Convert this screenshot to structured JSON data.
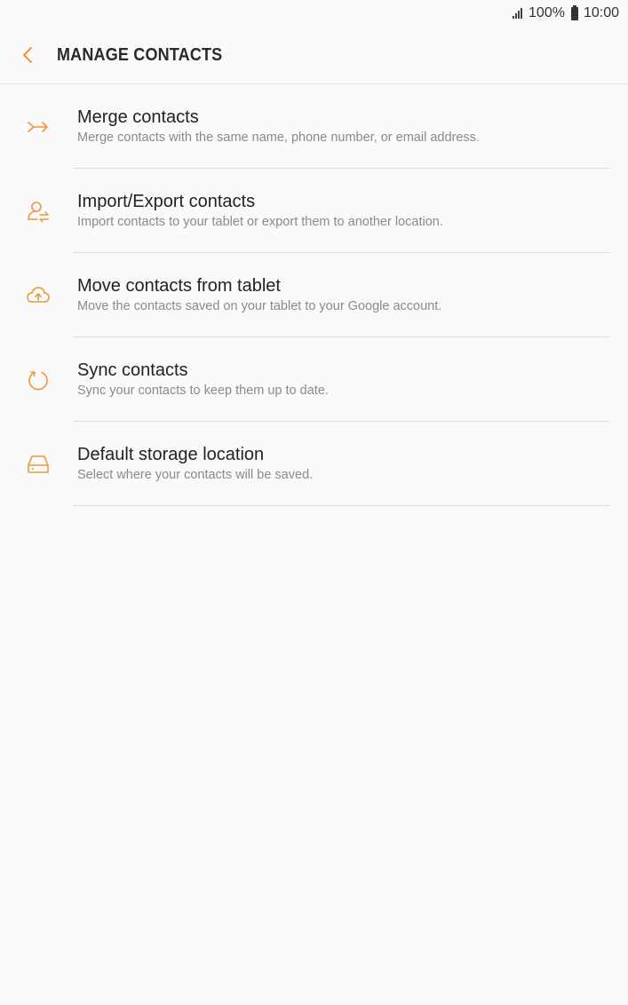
{
  "status_bar": {
    "battery_percent": "100%",
    "time": "10:00"
  },
  "header": {
    "title": "MANAGE CONTACTS",
    "back_icon": "chevron-left-icon"
  },
  "accent_color": "#f0953a",
  "items": [
    {
      "icon": "merge-icon",
      "title": "Merge contacts",
      "subtitle": "Merge contacts with the same name, phone number, or email address."
    },
    {
      "icon": "import-export-icon",
      "title": "Import/Export contacts",
      "subtitle": "Import contacts to your tablet or export them to another location."
    },
    {
      "icon": "cloud-upload-icon",
      "title": "Move contacts from tablet",
      "subtitle": "Move the contacts saved on your tablet to your Google account."
    },
    {
      "icon": "sync-icon",
      "title": "Sync contacts",
      "subtitle": "Sync your contacts to keep them up to date."
    },
    {
      "icon": "storage-icon",
      "title": "Default storage location",
      "subtitle": "Select where your contacts will be saved."
    }
  ]
}
